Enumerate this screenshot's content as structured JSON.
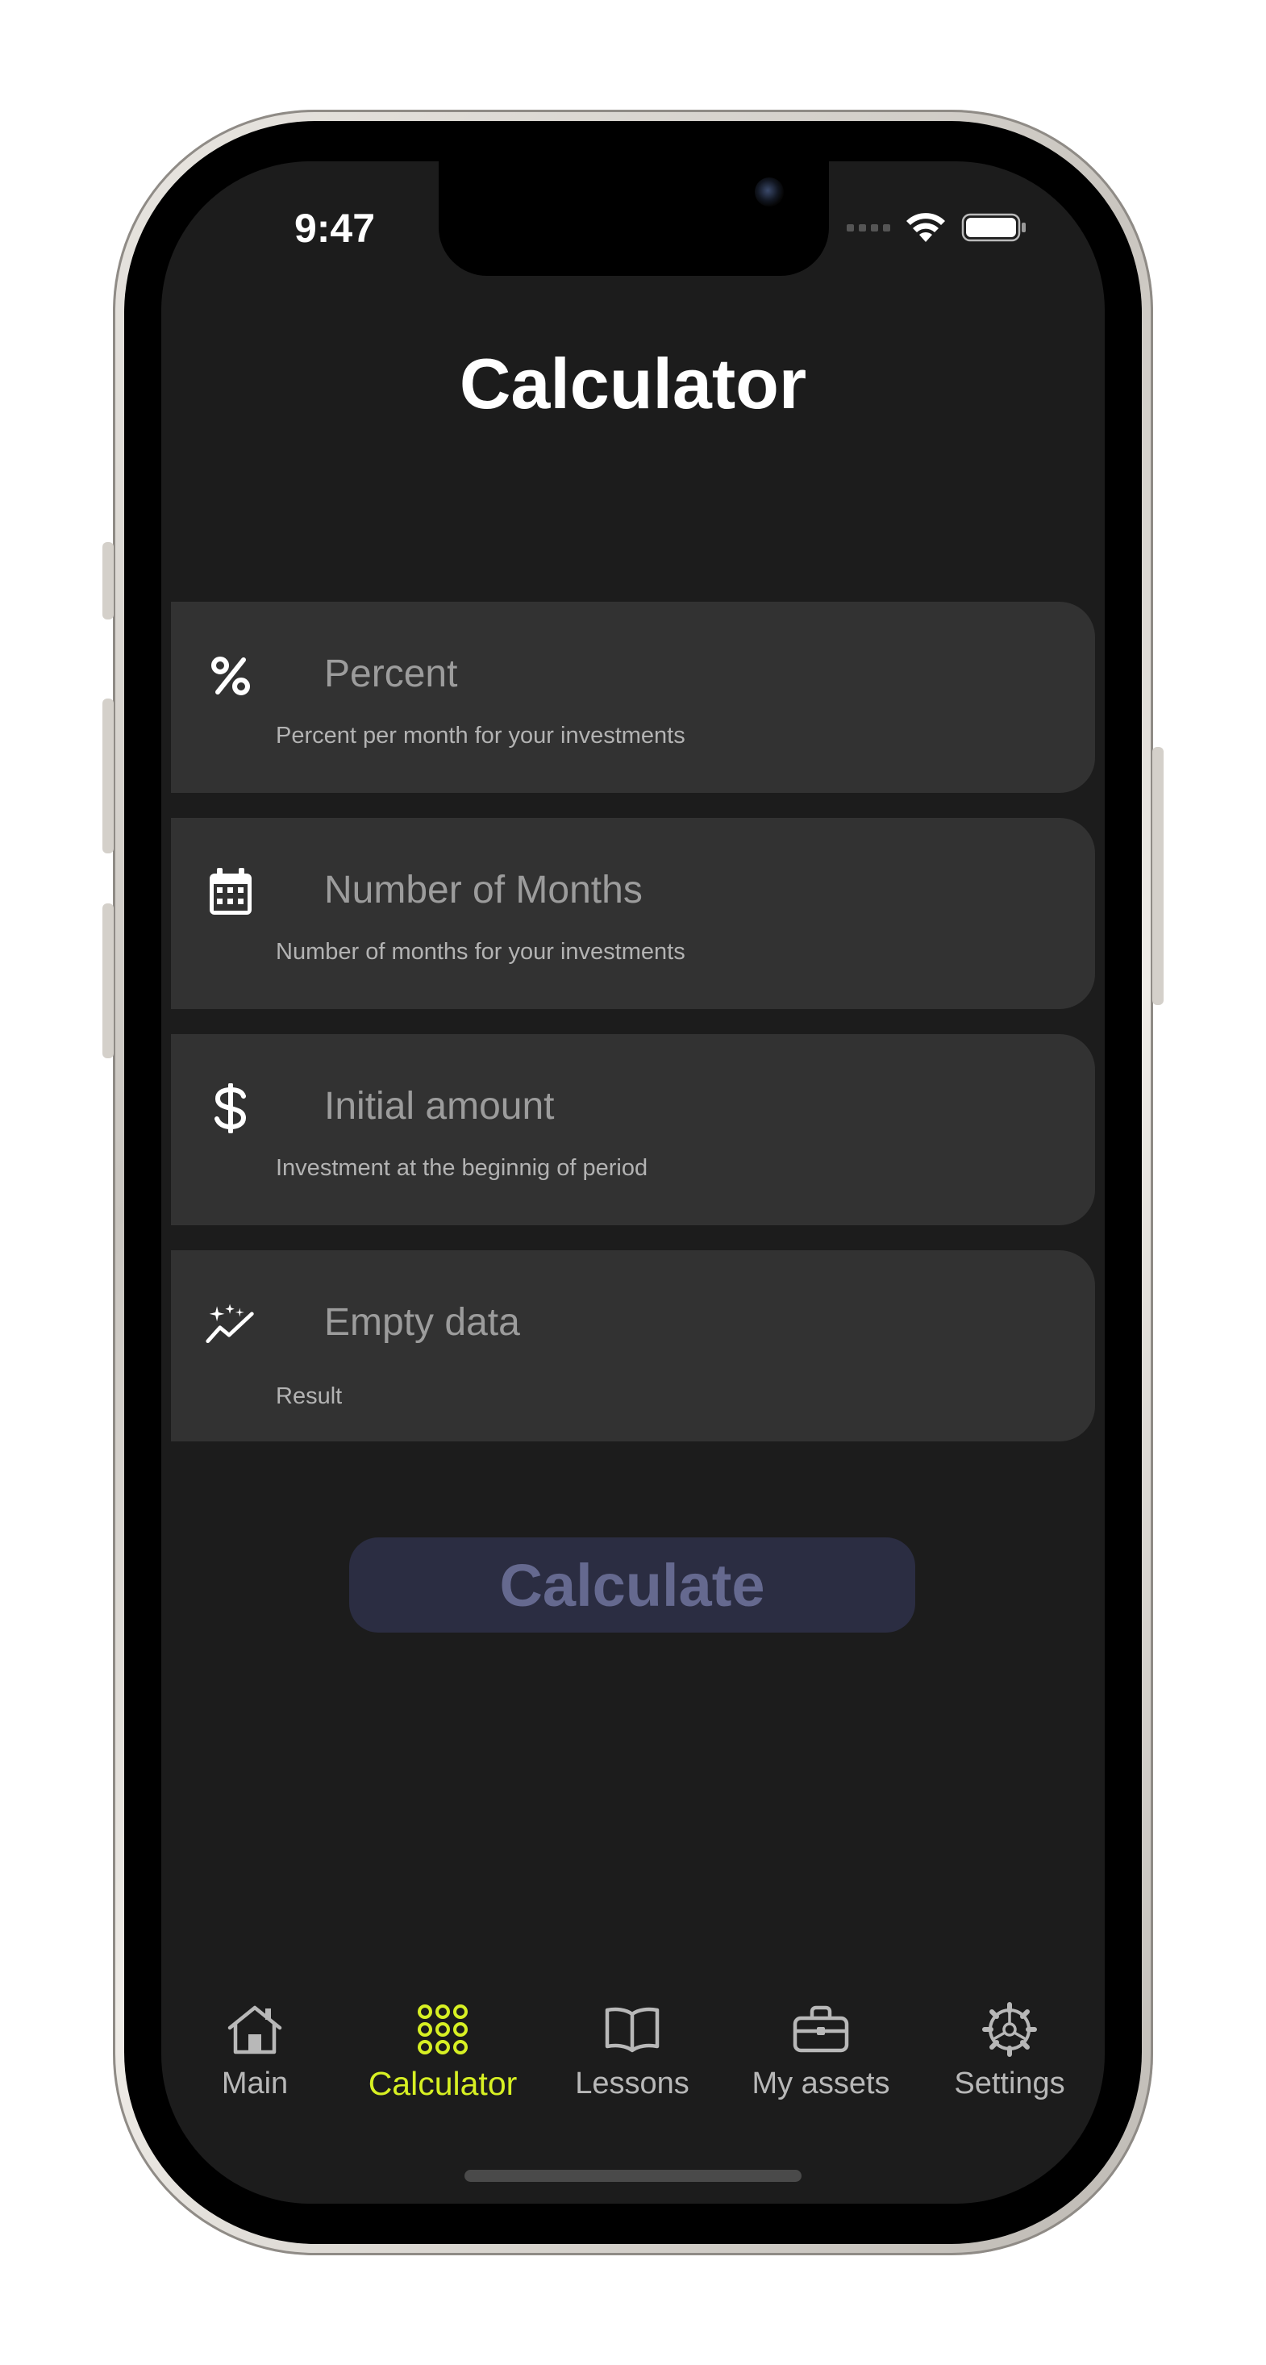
{
  "status_bar": {
    "time": "9:47"
  },
  "header": {
    "title": "Calculator"
  },
  "fields": [
    {
      "icon": "percent-icon",
      "placeholder": "Percent",
      "help": "Percent per month for your investments"
    },
    {
      "icon": "calendar-icon",
      "placeholder": "Number of Months",
      "help": "Number of months for your investments"
    },
    {
      "icon": "dollar-icon",
      "placeholder": "Initial amount",
      "help": "Investment at the beginnig of period"
    },
    {
      "icon": "sparkle-chart-icon",
      "placeholder": "Empty data",
      "help": "Result"
    }
  ],
  "actions": {
    "calculate_label": "Calculate"
  },
  "tabbar": {
    "active_color": "#d7f023",
    "items": [
      {
        "label": "Main",
        "icon": "home-icon",
        "active": false
      },
      {
        "label": "Calculator",
        "icon": "calculator-grid-icon",
        "active": true
      },
      {
        "label": "Lessons",
        "icon": "book-icon",
        "active": false
      },
      {
        "label": "My assets",
        "icon": "briefcase-icon",
        "active": false
      },
      {
        "label": "Settings",
        "icon": "gear-icon",
        "active": false
      }
    ]
  },
  "colors": {
    "background": "#1c1c1c",
    "card": "#323232",
    "button_bg": "#2b2d42",
    "button_text": "#65698f"
  }
}
